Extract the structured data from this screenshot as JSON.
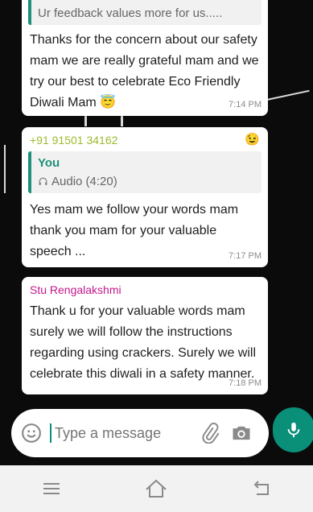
{
  "messages": [
    {
      "quote_snippet": "Ur feedback values more for us.....",
      "text": "Thanks for the concern about our safety mam we are really grateful mam and we try our best to celebrate Eco Friendly Diwali Mam",
      "emoji": "😇",
      "time": "7:14 PM"
    },
    {
      "sender": "+91 91501 34162",
      "reaction": "😉",
      "quote_author": "You",
      "quote_text": "Audio (4:20)",
      "text": "Yes mam we follow your words mam thank you mam for your valuable speech ...",
      "time": "7:17 PM"
    },
    {
      "sender": "Stu Rengalakshmi",
      "text": "Thank u  for your valuable words mam surely we will follow the instructions regarding using crackers. Surely we will celebrate this diwali in a safety manner.",
      "time": "7:18 PM"
    }
  ],
  "input": {
    "placeholder": "Type a message"
  },
  "colors": {
    "accent": "#0a8f79",
    "quote_bar": "#1f8f7a",
    "sender1": "#9bbc2c",
    "sender2": "#c2188b"
  },
  "icons": [
    "emoji-icon",
    "attach-icon",
    "camera-icon",
    "mic-icon",
    "menu-icon",
    "home-icon",
    "back-icon",
    "headphones-icon"
  ]
}
